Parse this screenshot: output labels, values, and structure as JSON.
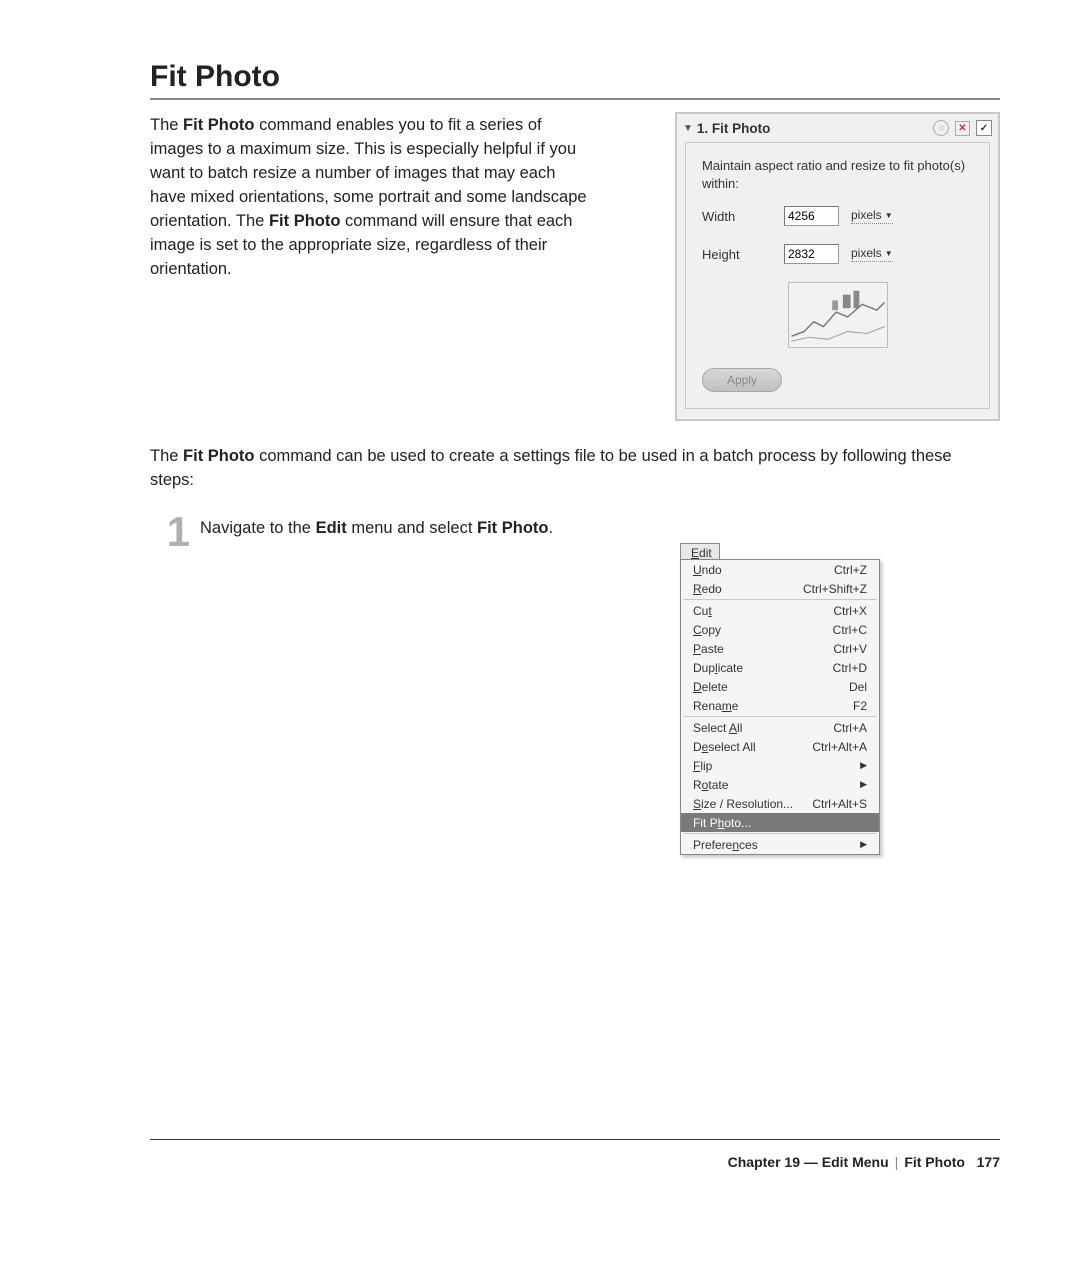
{
  "title": "Fit Photo",
  "intro_parts": {
    "p1": "The ",
    "b1": "Fit Photo",
    "p2": " command enables you to fit a series of images to a maximum size. This is especially helpful if you want to batch resize a number of images that may each have mixed orientations, some portrait and some landscape orientation. The ",
    "b2": "Fit Photo",
    "p3": " command will ensure that each image is set to the appropriate size, regardless of their orientation."
  },
  "dialog": {
    "title": "1. Fit Photo",
    "subtext": "Maintain aspect ratio and resize to fit photo(s) within:",
    "width_label": "Width",
    "width_value": "4256",
    "height_label": "Height",
    "height_value": "2832",
    "unit": "pixels",
    "apply": "Apply"
  },
  "para2_parts": {
    "p1": "The ",
    "b1": "Fit Photo",
    "p2": " command can be used to create a settings file to be used in a batch process by following these steps:"
  },
  "step": {
    "num": "1",
    "pre": "Navigate to the ",
    "b1": "Edit",
    "mid": " menu and select ",
    "b2": "Fit Photo",
    "post": "."
  },
  "menu": {
    "button": "Edit",
    "items": [
      {
        "label": "Undo",
        "shortcut": "Ctrl+Z",
        "u": 0
      },
      {
        "label": "Redo",
        "shortcut": "Ctrl+Shift+Z",
        "u": 0
      },
      {
        "sep": true
      },
      {
        "label": "Cut",
        "shortcut": "Ctrl+X",
        "u": 2
      },
      {
        "label": "Copy",
        "shortcut": "Ctrl+C",
        "u": 0
      },
      {
        "label": "Paste",
        "shortcut": "Ctrl+V",
        "u": 0
      },
      {
        "label": "Duplicate",
        "shortcut": "Ctrl+D",
        "u": 3
      },
      {
        "label": "Delete",
        "shortcut": "Del",
        "u": 0
      },
      {
        "label": "Rename",
        "shortcut": "F2",
        "u": 4
      },
      {
        "sep": true
      },
      {
        "label": "Select All",
        "shortcut": "Ctrl+A",
        "u": 7
      },
      {
        "label": "Deselect All",
        "shortcut": "Ctrl+Alt+A",
        "u": 1
      },
      {
        "label": "Flip",
        "submenu": true,
        "u": 0
      },
      {
        "label": "Rotate",
        "submenu": true,
        "u": 1
      },
      {
        "label": "Size / Resolution...",
        "shortcut": "Ctrl+Alt+S",
        "u": 0
      },
      {
        "label": "Fit Photo...",
        "highlight": true,
        "u": 5
      },
      {
        "sep": true
      },
      {
        "label": "Preferences",
        "submenu": true,
        "u": 7
      }
    ]
  },
  "footer": {
    "chapter": "Chapter 19 — Edit Menu",
    "section": "Fit Photo",
    "page": "177"
  }
}
